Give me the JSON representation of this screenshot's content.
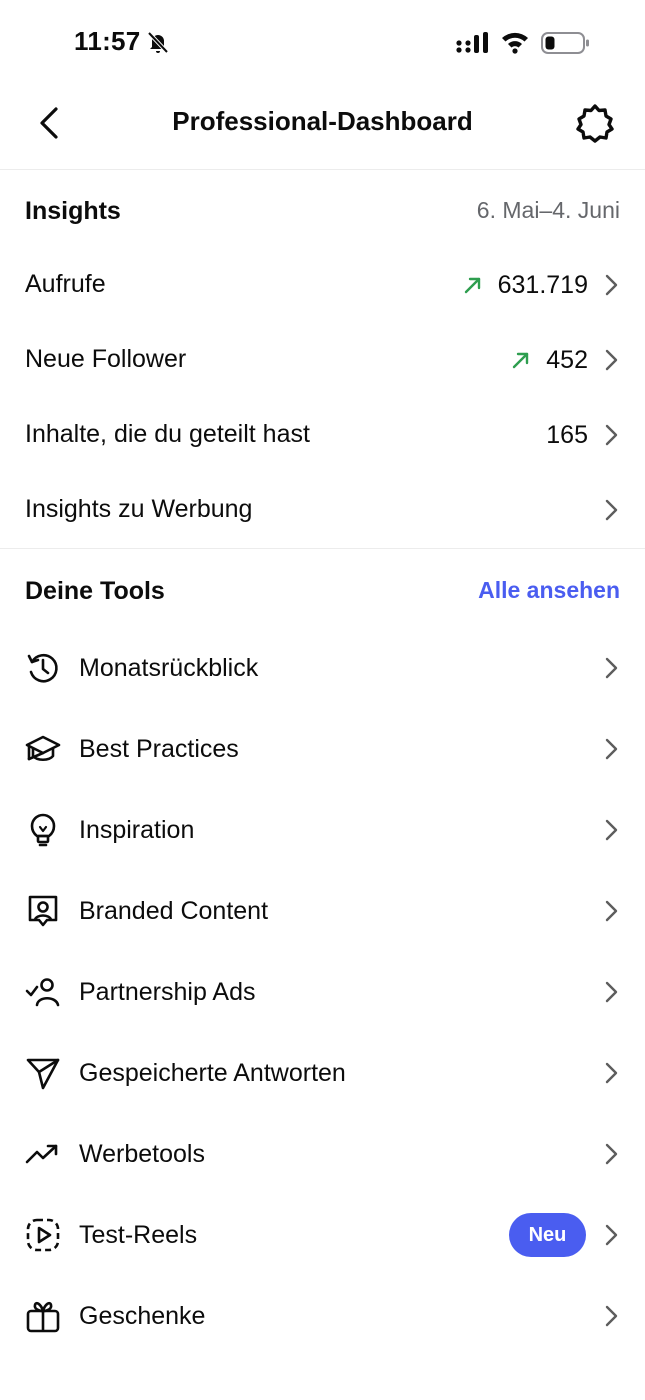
{
  "status_bar": {
    "time": "11:57"
  },
  "header": {
    "title": "Professional-Dashboard"
  },
  "insights": {
    "title": "Insights",
    "date_range": "6. Mai–4. Juni",
    "rows": [
      {
        "label": "Aufrufe",
        "value": "631.719",
        "trend": "up"
      },
      {
        "label": "Neue Follower",
        "value": "452",
        "trend": "up"
      },
      {
        "label": "Inhalte, die du geteilt hast",
        "value": "165",
        "trend": "none"
      },
      {
        "label": "Insights zu Werbung",
        "value": "",
        "trend": "none"
      }
    ]
  },
  "tools": {
    "title": "Deine Tools",
    "see_all": "Alle ansehen",
    "items": [
      {
        "label": "Monatsrückblick",
        "icon": "history-icon"
      },
      {
        "label": "Best Practices",
        "icon": "graduation-cap-icon"
      },
      {
        "label": "Inspiration",
        "icon": "lightbulb-icon"
      },
      {
        "label": "Branded Content",
        "icon": "user-badge-icon"
      },
      {
        "label": "Partnership Ads",
        "icon": "user-check-icon"
      },
      {
        "label": "Gespeicherte Antworten",
        "icon": "paper-plane-icon"
      },
      {
        "label": "Werbetools",
        "icon": "trending-up-icon"
      },
      {
        "label": "Test-Reels",
        "icon": "reels-icon",
        "badge": "Neu"
      },
      {
        "label": "Geschenke",
        "icon": "gift-icon"
      }
    ]
  },
  "colors": {
    "accent": "#4a5df0",
    "trend_up": "#2e9e4f",
    "muted": "#65676b"
  }
}
